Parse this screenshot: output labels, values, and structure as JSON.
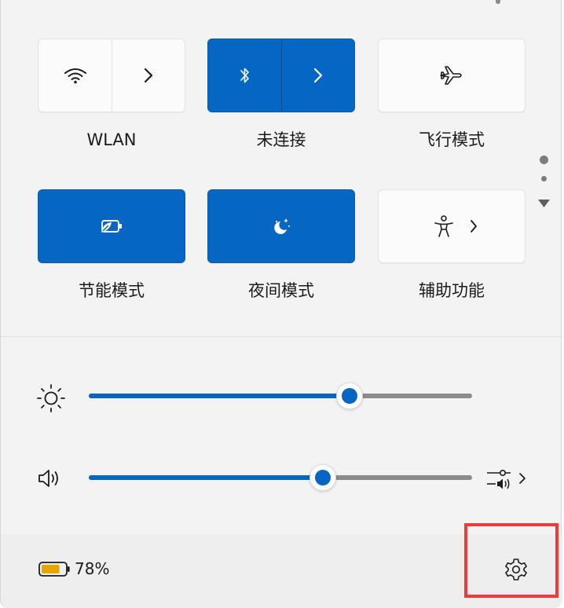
{
  "quick_settings": {
    "tiles": [
      {
        "id": "wlan",
        "label": "WLAN",
        "active": false,
        "icon": "wifi-icon",
        "has_expand": true
      },
      {
        "id": "bluetooth",
        "label": "未连接",
        "active": true,
        "icon": "bluetooth-icon",
        "has_expand": true
      },
      {
        "id": "airplane",
        "label": "飞行模式",
        "active": false,
        "icon": "airplane-icon",
        "has_expand": false
      },
      {
        "id": "battery-saver",
        "label": "节能模式",
        "active": true,
        "icon": "battery-saver-icon",
        "has_expand": false
      },
      {
        "id": "night-light",
        "label": "夜间模式",
        "active": true,
        "icon": "night-light-icon",
        "has_expand": false
      },
      {
        "id": "accessibility",
        "label": "辅助功能",
        "active": false,
        "icon": "accessibility-icon",
        "has_expand": true
      }
    ],
    "pager": {
      "pages": 2,
      "current": 0
    }
  },
  "sliders": {
    "brightness": {
      "icon": "brightness-icon",
      "value_percent": 68
    },
    "volume": {
      "icon": "speaker-icon",
      "value_percent": 61,
      "output_icon": "audio-output-icon"
    }
  },
  "footer": {
    "battery_icon": "battery-icon",
    "battery_percent": "78%",
    "settings_icon": "gear-icon"
  },
  "colors": {
    "accent": "#0566c3",
    "battery_fill": "#e8a400",
    "highlight": "#ee3a3a"
  }
}
